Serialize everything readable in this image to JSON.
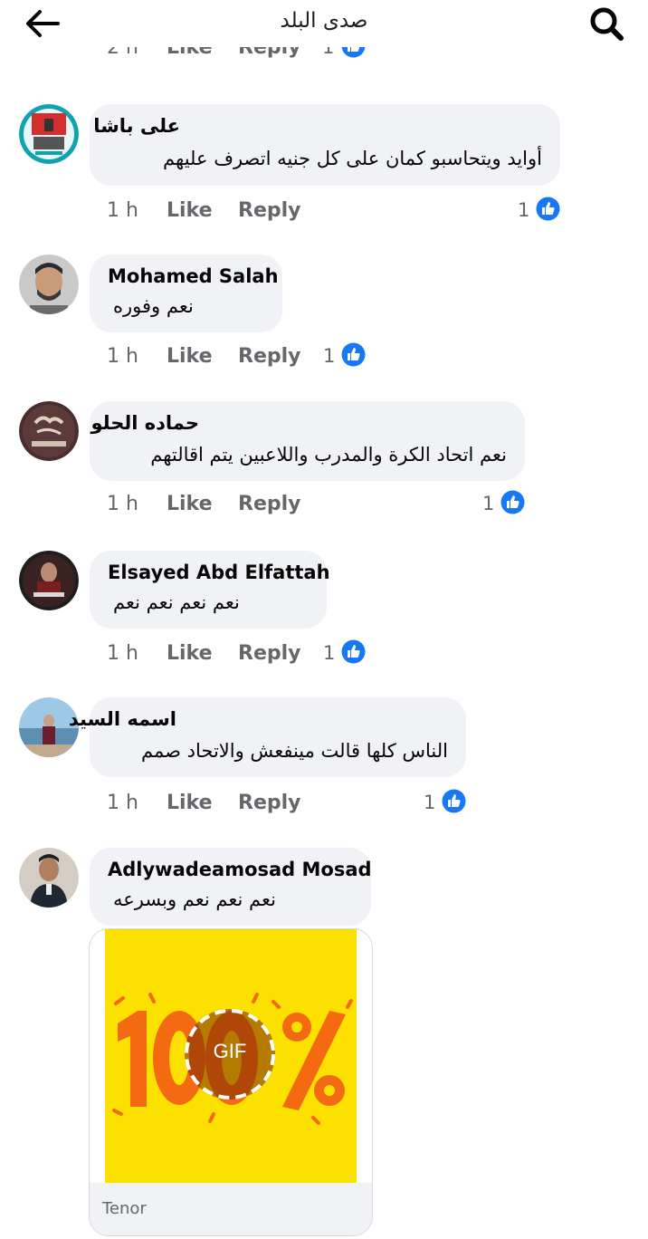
{
  "header": {
    "title": "صدى البلد",
    "back_icon": "arrow-left-icon",
    "search_icon": "search-icon"
  },
  "previous_actions": {
    "time": "2 h",
    "like": "Like",
    "reply": "Reply",
    "count": "1"
  },
  "comments": [
    {
      "author": "على باشا",
      "text": "أوايد ويتحاسبو كمان على كل جنيه اتصرف عليهم",
      "time": "1 h",
      "like": "Like",
      "reply": "Reply",
      "reactions": "1"
    },
    {
      "author": "Mohamed Salah",
      "text": "نعم وفوره",
      "time": "1 h",
      "like": "Like",
      "reply": "Reply",
      "reactions": "1"
    },
    {
      "author": "حماده الحلو",
      "text": "نعم اتحاد الكرة والمدرب واللاعبين يتم اقالتهم",
      "time": "1 h",
      "like": "Like",
      "reply": "Reply",
      "reactions": "1"
    },
    {
      "author": "Elsayed Abd Elfattah",
      "text": "نعم نعم نعم نعم",
      "time": "1 h",
      "like": "Like",
      "reply": "Reply",
      "reactions": "1"
    },
    {
      "author": "اسمه السيد",
      "text": "الناس كلها قالت مينفعش والاتحاد صمم",
      "time": "1 h",
      "like": "Like",
      "reply": "Reply",
      "reactions": "1"
    },
    {
      "author": "Adlywadeamosad Mosad",
      "text": "نعم نعم نعم وبسرعه"
    }
  ],
  "gif": {
    "badge": "GIF",
    "source": "Tenor",
    "content": "100%"
  },
  "colors": {
    "bubble": "#f0f2f5",
    "secondary_text": "#65676b",
    "like_blue": "#1877f2",
    "gif_background": "#fce000",
    "gif_numerals": "#f46a12"
  }
}
